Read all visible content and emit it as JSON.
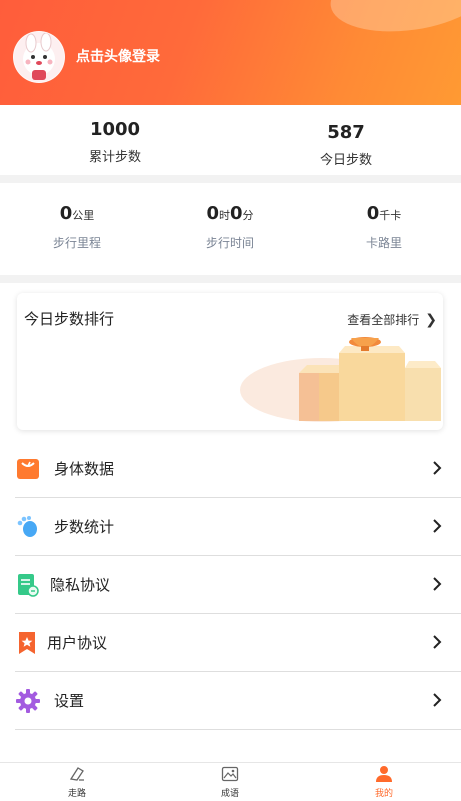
{
  "header": {
    "login_text": "点击头像登录"
  },
  "summary": {
    "total_steps_value": "1000",
    "total_steps_label": "累计步数",
    "today_steps_value": "587",
    "today_steps_label": "今日步数"
  },
  "metrics": {
    "distance": {
      "value": "0",
      "unit": "公里",
      "label": "步行里程"
    },
    "time": {
      "hours": "0",
      "hours_unit": "时",
      "minutes": "0",
      "minutes_unit": "分",
      "label": "步行时间"
    },
    "calories": {
      "value": "0",
      "unit": "千卡",
      "label": "卡路里"
    }
  },
  "ranking_card": {
    "title": "今日步数排行",
    "link": "查看全部排行"
  },
  "menu": {
    "items": [
      {
        "label": "身体数据",
        "icon": "scale-icon"
      },
      {
        "label": "步数统计",
        "icon": "footprints-icon"
      },
      {
        "label": "隐私协议",
        "icon": "document-icon"
      },
      {
        "label": "用户协议",
        "icon": "bookmark-star-icon"
      },
      {
        "label": "设置",
        "icon": "gear-icon"
      }
    ]
  },
  "tabbar": {
    "tabs": [
      {
        "label": "走路",
        "icon": "walk-icon",
        "active": false
      },
      {
        "label": "成语",
        "icon": "image-icon",
        "active": false
      },
      {
        "label": "我的",
        "icon": "person-icon",
        "active": true
      }
    ]
  },
  "colors": {
    "header_start": "#ff5d3b",
    "header_end": "#ff9a33",
    "accent": "#ff6a2b"
  }
}
